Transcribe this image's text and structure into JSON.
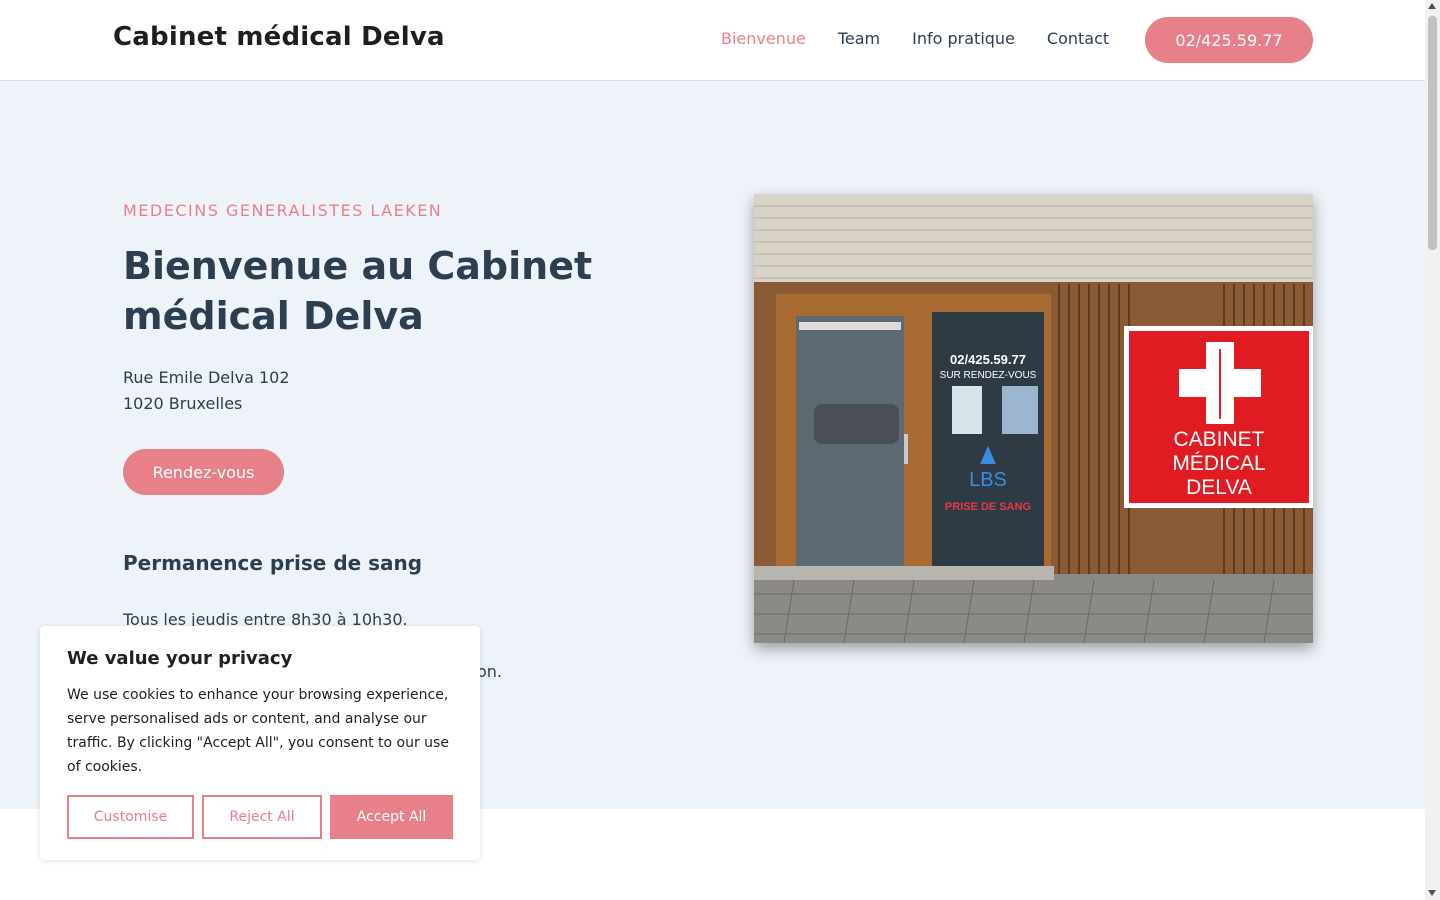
{
  "header": {
    "logo": "Cabinet médical Delva",
    "nav": [
      {
        "label": "Bienvenue",
        "active": true
      },
      {
        "label": "Team",
        "active": false
      },
      {
        "label": "Info pratique",
        "active": false
      },
      {
        "label": "Contact",
        "active": false
      }
    ],
    "phone": "02/425.59.77"
  },
  "hero": {
    "eyebrow": "MEDECINS GENERALISTES LAEKEN",
    "title": "Bienvenue au Cabinet médical Delva",
    "address_line1": "Rue Emile Delva 102",
    "address_line2": "1020 Bruxelles",
    "rdv_button": "Rendez-vous",
    "subtitle": "Permanence prise de sang",
    "text1": "Tous les jeudis entre 8h30 à 10h30.",
    "text2": "on."
  },
  "photo": {
    "sign_line1": "CABINET",
    "sign_line2": "MÉDICAL",
    "sign_line3": "DELVA",
    "window_phone": "02/425.59.77",
    "window_rdv": "SUR RENDEZ-VOUS",
    "window_lbs": "LBS",
    "window_prise": "PRISE DE SANG"
  },
  "cookie": {
    "title": "We value your privacy",
    "text": "We use cookies to enhance your browsing experience, serve personalised ads or content, and analyse our traffic. By clicking \"Accept All\", you consent to our use of cookies.",
    "customise": "Customise",
    "reject": "Reject All",
    "accept": "Accept All"
  },
  "colors": {
    "accent": "#e8808a",
    "text": "#2d3e50",
    "hero_bg": "#eef3f9"
  }
}
